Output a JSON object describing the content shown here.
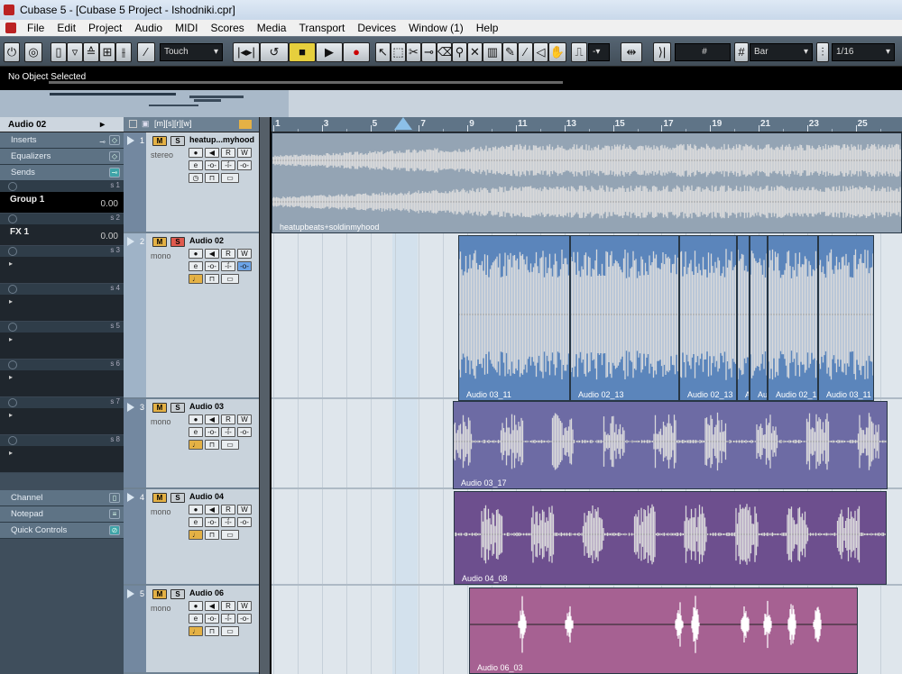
{
  "window": {
    "title": "Cubase 5 - [Cubase 5 Project - Ishodniki.cpr]"
  },
  "menu": [
    "File",
    "Edit",
    "Project",
    "Audio",
    "MIDI",
    "Scores",
    "Media",
    "Transport",
    "Devices",
    "Window (1)",
    "Help"
  ],
  "toolbar": {
    "automation_mode": "Touch",
    "grid_type": "Bar",
    "quantize": "1/16",
    "nudge_value": "-"
  },
  "infoline": {
    "text": "No Object Selected"
  },
  "inspector": {
    "track_name": "Audio 02",
    "sections": [
      "Inserts",
      "Equalizers",
      "Sends"
    ],
    "send_slots": [
      {
        "num": "s 1",
        "name": "Group 1",
        "value": "0.00"
      },
      {
        "num": "s 2",
        "name": "FX 1",
        "value": "0.00"
      },
      {
        "num": "s 3",
        "name": "",
        "value": ""
      },
      {
        "num": "s 4",
        "name": "",
        "value": ""
      },
      {
        "num": "s 5",
        "name": "",
        "value": ""
      },
      {
        "num": "s 6",
        "name": "",
        "value": ""
      },
      {
        "num": "s 7",
        "name": "",
        "value": ""
      },
      {
        "num": "s 8",
        "name": "",
        "value": ""
      }
    ],
    "bottom_sections": [
      "Channel",
      "Notepad",
      "Quick Controls"
    ]
  },
  "tracks": [
    {
      "num": "1",
      "name": "heatup...myhood",
      "type": "stereo",
      "mute": "M",
      "solo": "S",
      "solo_on": false
    },
    {
      "num": "2",
      "name": "Audio 02",
      "type": "mono",
      "mute": "M",
      "solo": "S",
      "solo_on": true
    },
    {
      "num": "3",
      "name": "Audio 03",
      "type": "mono",
      "mute": "M",
      "solo": "S",
      "solo_on": false
    },
    {
      "num": "4",
      "name": "Audio 04",
      "type": "mono",
      "mute": "M",
      "solo": "S",
      "solo_on": false
    },
    {
      "num": "5",
      "name": "Audio 06",
      "type": "mono",
      "mute": "M",
      "solo": "S",
      "solo_on": false
    }
  ],
  "ruler": {
    "bars": [
      "1",
      "3",
      "5",
      "7",
      "9",
      "11",
      "13",
      "15",
      "17",
      "19",
      "21",
      "23",
      "25"
    ]
  },
  "events": [
    {
      "label": "heatupbeats+soldinmyhood",
      "color": "#94a4b4"
    },
    {
      "label": "Audio 03_11",
      "color": "#5b85bb"
    },
    {
      "label": "Audio 02_13",
      "color": "#5b85bb"
    },
    {
      "label": "Audio 02_13",
      "color": "#5b85bb"
    },
    {
      "label": "A",
      "color": "#5b85bb"
    },
    {
      "label": "Au",
      "color": "#5b85bb"
    },
    {
      "label": "Audio 02_1",
      "color": "#5b85bb"
    },
    {
      "label": "Audio 03_11",
      "color": "#5b85bb"
    },
    {
      "label": "Audio 03_17",
      "color": "#6d6ba4"
    },
    {
      "label": "Audio 04_08",
      "color": "#6d4f8e"
    },
    {
      "label": "Audio 06_03",
      "color": "#a66192"
    }
  ],
  "colors": {
    "accent": "#e4b145",
    "solo_on": "#e05a4e",
    "waveform": "#ffffff"
  }
}
